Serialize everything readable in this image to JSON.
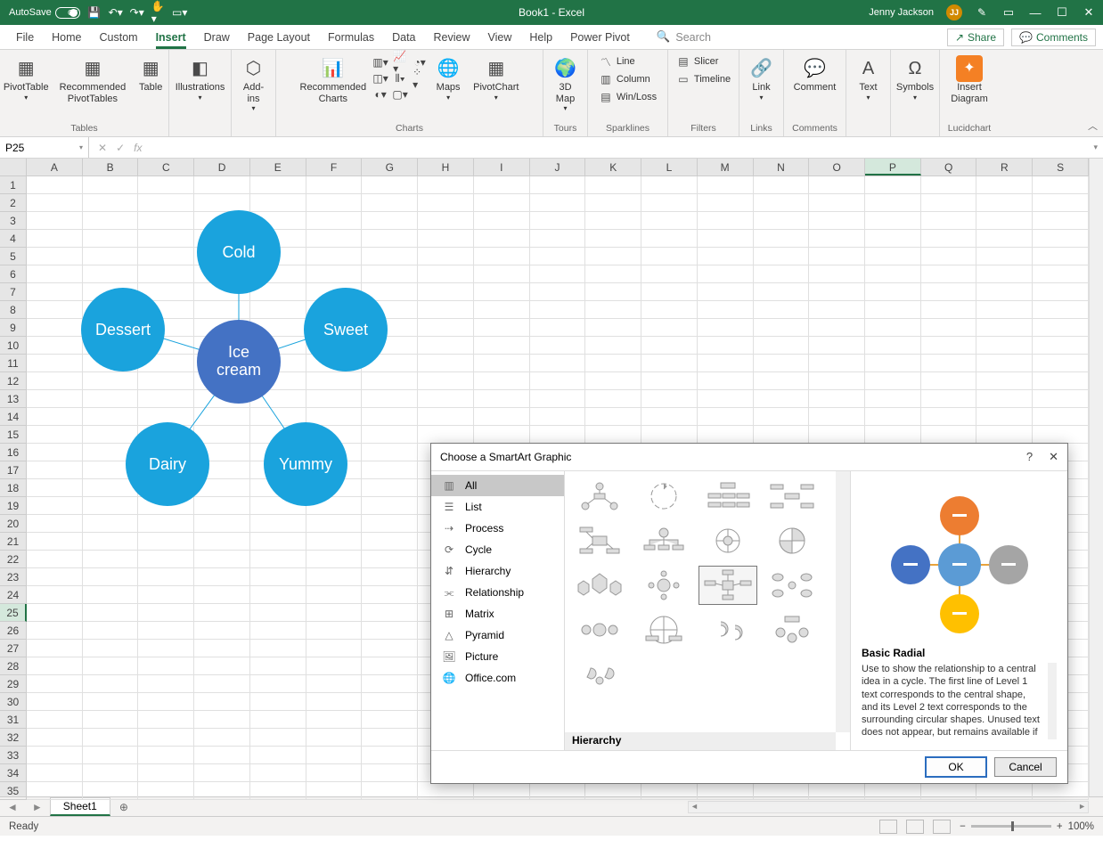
{
  "titlebar": {
    "autosave_label": "AutoSave",
    "autosave_state": "Off",
    "title": "Book1 - Excel",
    "user_name": "Jenny Jackson",
    "user_initials": "JJ"
  },
  "tabs": {
    "items": [
      "File",
      "Home",
      "Custom",
      "Insert",
      "Draw",
      "Page Layout",
      "Formulas",
      "Data",
      "Review",
      "View",
      "Help",
      "Power Pivot"
    ],
    "active_index": 3,
    "search_placeholder": "Search",
    "share": "Share",
    "comments": "Comments"
  },
  "ribbon": {
    "groups": [
      {
        "label": "Tables",
        "buttons": [
          {
            "label": "PivotTable"
          },
          {
            "label": "Recommended\nPivotTables"
          },
          {
            "label": "Table"
          }
        ]
      },
      {
        "label": "",
        "buttons": [
          {
            "label": "Illustrations"
          }
        ]
      },
      {
        "label": "",
        "buttons": [
          {
            "label": "Add-\nins"
          }
        ]
      },
      {
        "label": "Charts",
        "buttons": [
          {
            "label": "Recommended\nCharts"
          }
        ],
        "mini_cols": 3,
        "extra": [
          "Maps",
          "PivotChart"
        ]
      },
      {
        "label": "Tours",
        "buttons": [
          {
            "label": "3D\nMap"
          }
        ]
      },
      {
        "label": "Sparklines",
        "mini": [
          "Line",
          "Column",
          "Win/Loss"
        ]
      },
      {
        "label": "Filters",
        "mini": [
          "Slicer",
          "Timeline"
        ]
      },
      {
        "label": "Links",
        "buttons": [
          {
            "label": "Link"
          }
        ]
      },
      {
        "label": "Comments",
        "buttons": [
          {
            "label": "Comment"
          }
        ]
      },
      {
        "label": "",
        "buttons": [
          {
            "label": "Text"
          }
        ]
      },
      {
        "label": "",
        "buttons": [
          {
            "label": "Symbols"
          }
        ]
      },
      {
        "label": "Lucidchart",
        "buttons": [
          {
            "label": "Insert\nDiagram"
          }
        ]
      }
    ]
  },
  "formula_bar": {
    "namebox": "P25"
  },
  "grid": {
    "columns": [
      "A",
      "B",
      "C",
      "D",
      "E",
      "F",
      "G",
      "H",
      "I",
      "J",
      "K",
      "L",
      "M",
      "N",
      "O",
      "P",
      "Q",
      "R",
      "S"
    ],
    "active_col": "P",
    "rows": 35,
    "active_row": 25
  },
  "smartart": {
    "center": "Ice\ncream",
    "nodes": [
      "Cold",
      "Sweet",
      "Yummy",
      "Dairy",
      "Dessert"
    ]
  },
  "dialog": {
    "title": "Choose a SmartArt Graphic",
    "categories": [
      "All",
      "List",
      "Process",
      "Cycle",
      "Hierarchy",
      "Relationship",
      "Matrix",
      "Pyramid",
      "Picture",
      "Office.com"
    ],
    "selected_category_index": 0,
    "grid_section_label": "Hierarchy",
    "preview_name": "Basic Radial",
    "preview_desc": "Use to show the relationship to a central idea in a cycle. The first line of Level 1 text corresponds to the central shape, and its Level 2 text corresponds to the surrounding circular shapes. Unused text does not appear, but remains available if you switch",
    "ok": "OK",
    "cancel": "Cancel"
  },
  "sheets": {
    "active": "Sheet1"
  },
  "statusbar": {
    "left": "Ready",
    "zoom": "100%"
  }
}
